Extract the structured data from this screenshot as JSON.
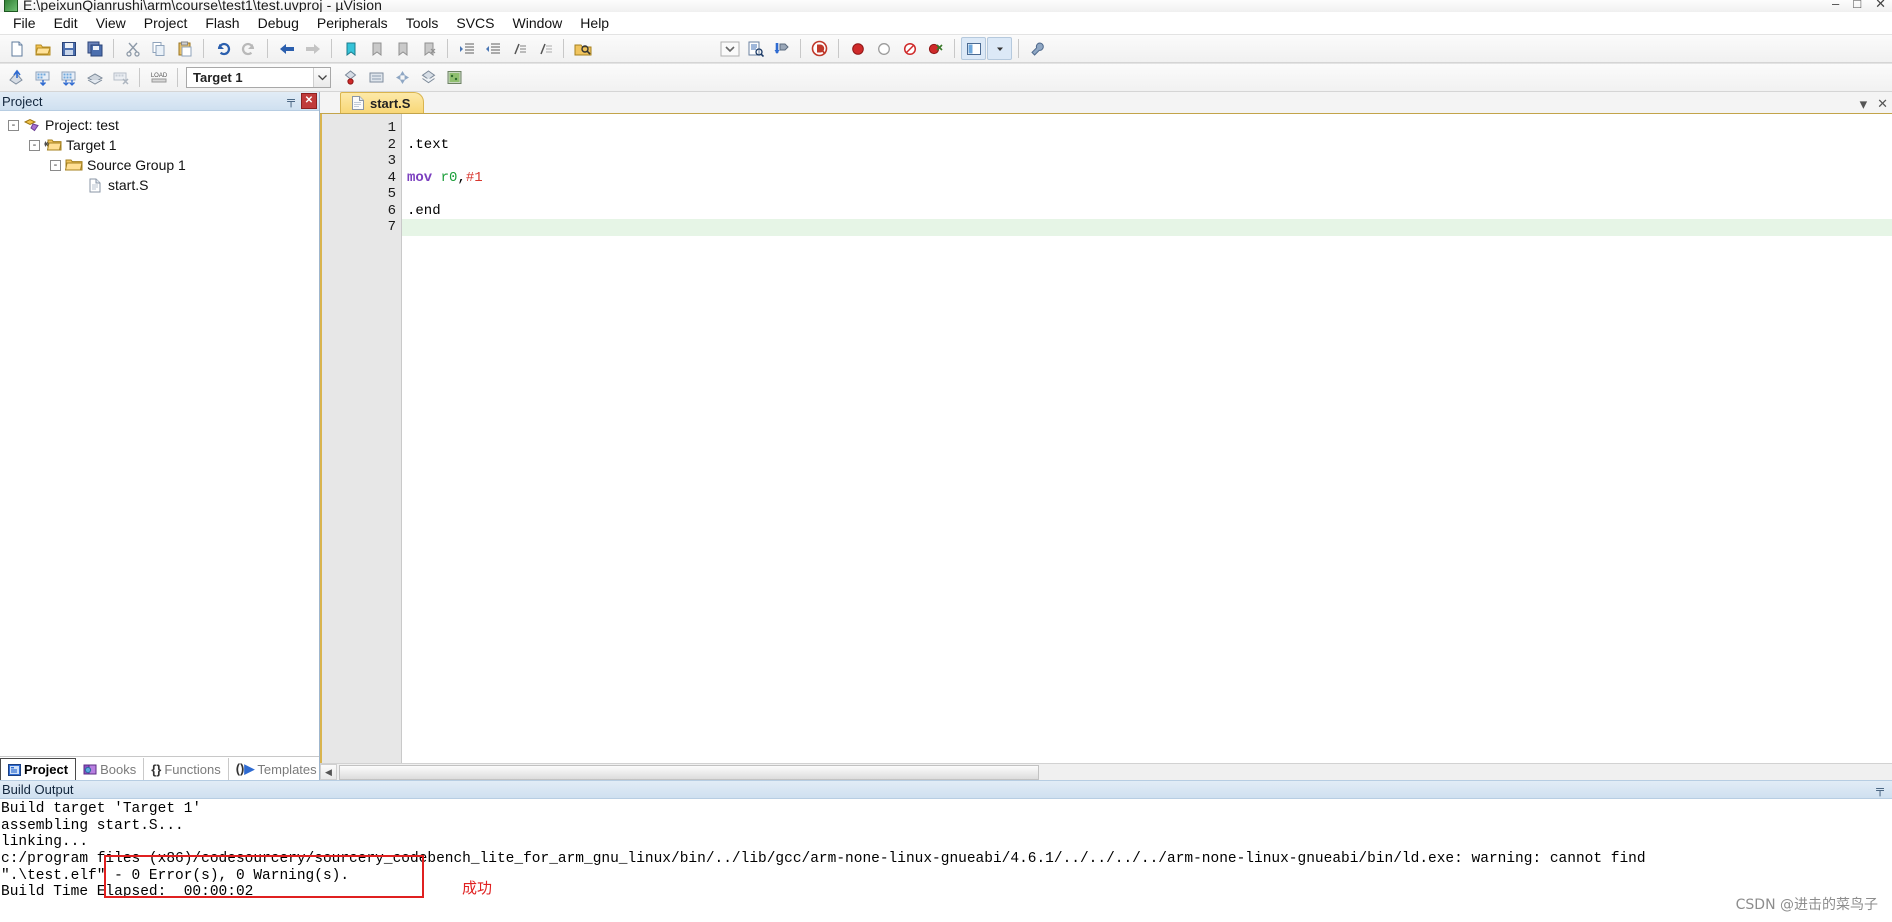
{
  "window": {
    "title": "E:\\peixunQianrushi\\arm\\course\\test1\\test.uvproj - µVision",
    "icon": "uvision-app-icon",
    "minimize": "–",
    "maximize": "□",
    "close": "✕"
  },
  "menu": {
    "items": [
      {
        "label": "File",
        "name": "menu-file"
      },
      {
        "label": "Edit",
        "name": "menu-edit"
      },
      {
        "label": "View",
        "name": "menu-view"
      },
      {
        "label": "Project",
        "name": "menu-project"
      },
      {
        "label": "Flash",
        "name": "menu-flash"
      },
      {
        "label": "Debug",
        "name": "menu-debug"
      },
      {
        "label": "Peripherals",
        "name": "menu-peripherals"
      },
      {
        "label": "Tools",
        "name": "menu-tools"
      },
      {
        "label": "SVCS",
        "name": "menu-svcs"
      },
      {
        "label": "Window",
        "name": "menu-window"
      },
      {
        "label": "Help",
        "name": "menu-help"
      }
    ]
  },
  "toolbar_main": {
    "buttons": [
      "new-file-icon",
      "open-file-icon",
      "save-icon",
      "save-all-icon",
      "cut-icon",
      "copy-icon",
      "paste-icon",
      "undo-icon",
      "redo-icon",
      "navigate-back-icon",
      "navigate-forward-icon",
      "bookmark-toggle-icon",
      "bookmark-prev-icon",
      "bookmark-next-icon",
      "bookmark-clear-icon",
      "indent-icon",
      "outdent-icon",
      "comment-icon",
      "uncomment-icon",
      "find-in-files-icon"
    ],
    "right_buttons": [
      "combo-arrow-icon",
      "configure-icon",
      "debug-settings-icon",
      "start-debug-icon",
      "insert-breakpoint-icon",
      "disable-breakpoint-icon",
      "disable-all-breakpoints-icon",
      "kill-all-breakpoints-icon",
      "window-layout-icon",
      "layout-dropdown-icon",
      "configure-tools-icon"
    ]
  },
  "toolbar_build": {
    "buttons": [
      "translate-icon",
      "build-icon",
      "rebuild-all-icon",
      "batch-build-icon",
      "stop-build-icon",
      "download-icon"
    ],
    "target": {
      "label": "Target 1",
      "dropdown_arrow": "▾",
      "name": "target-selector"
    },
    "after_target": [
      "select-target-icon",
      "manage-project-items-icon",
      "options-for-target-icon",
      "manage-run-time-env-icon",
      "package-installer-icon",
      "open-build-log-icon"
    ]
  },
  "project_pane": {
    "header": "Project",
    "pin": "╤",
    "close": "✕",
    "tree": [
      {
        "level": 0,
        "expander": "-",
        "icon": "project-icon",
        "label": "Project: test",
        "name": "tree-node-project"
      },
      {
        "level": 1,
        "expander": "-",
        "icon": "target-folder-icon",
        "label": "Target 1",
        "name": "tree-node-target"
      },
      {
        "level": 2,
        "expander": "-",
        "icon": "group-folder-icon",
        "label": "Source Group 1",
        "name": "tree-node-source-group"
      },
      {
        "level": 3,
        "expander": "",
        "icon": "source-file-icon",
        "label": "start.S",
        "name": "tree-node-file-start-s"
      }
    ],
    "tabs": [
      {
        "label": "Project",
        "icon": "project-tab-icon",
        "active": true,
        "name": "pane-tab-project"
      },
      {
        "label": "Books",
        "icon": "books-tab-icon",
        "active": false,
        "name": "pane-tab-books"
      },
      {
        "label": "Functions",
        "icon": "functions-tab-icon",
        "active": false,
        "name": "pane-tab-functions"
      },
      {
        "label": "Templates",
        "icon": "templates-tab-icon",
        "active": false,
        "name": "pane-tab-templates"
      }
    ]
  },
  "editor": {
    "tab": {
      "label": "start.S",
      "icon": "document-icon"
    },
    "tabstrip_right": {
      "dropdown": "▾",
      "close": "✕"
    },
    "current_line": 7,
    "lines": [
      {
        "n": 1,
        "tokens": []
      },
      {
        "n": 2,
        "tokens": [
          {
            "t": ".text",
            "c": "k-dir"
          }
        ]
      },
      {
        "n": 3,
        "tokens": []
      },
      {
        "n": 4,
        "tokens": [
          {
            "t": "mov",
            "c": "k-mnem"
          },
          {
            "t": " ",
            "c": "k-punct"
          },
          {
            "t": "r0",
            "c": "k-reg"
          },
          {
            "t": ",",
            "c": "k-punct"
          },
          {
            "t": "#1",
            "c": "k-num"
          }
        ]
      },
      {
        "n": 5,
        "tokens": []
      },
      {
        "n": 6,
        "tokens": [
          {
            "t": ".end",
            "c": "k-dir"
          }
        ]
      },
      {
        "n": 7,
        "tokens": []
      }
    ],
    "hscroll": {
      "left_arrow": "◀",
      "right_arrow": "▶"
    }
  },
  "build_output": {
    "header": "Build Output",
    "pin": "╤",
    "lines": [
      "Build target 'Target 1'",
      "assembling start.S...",
      "linking...",
      "c:/program files (x86)/codesourcery/sourcery_codebench_lite_for_arm_gnu_linux/bin/../lib/gcc/arm-none-linux-gnueabi/4.6.1/../../../../arm-none-linux-gnueabi/bin/ld.exe: warning: cannot find",
      "\".\\test.elf\" - 0 Error(s), 0 Warning(s).",
      "Build Time Elapsed:  00:00:02"
    ],
    "annotation": {
      "text": "成功",
      "color": "#e02020"
    }
  },
  "watermark": "CSDN @进击的菜鸟子"
}
